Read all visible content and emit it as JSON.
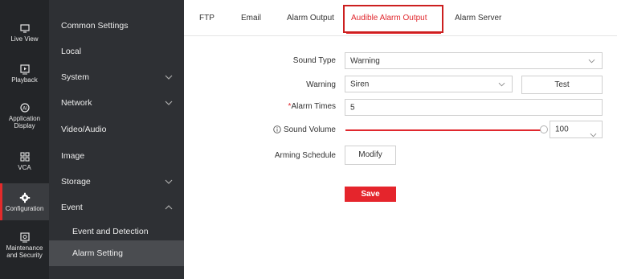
{
  "rail": [
    {
      "label": "Live View",
      "icon": "monitor-icon"
    },
    {
      "label": "Playback",
      "icon": "playback-icon"
    },
    {
      "label": "Application Display",
      "icon": "application-icon"
    },
    {
      "label": "VCA",
      "icon": "vca-icon"
    },
    {
      "label": "Configuration",
      "icon": "gear-icon",
      "active": true
    },
    {
      "label": "Maintenance and Security",
      "icon": "maintenance-icon"
    }
  ],
  "menu": [
    {
      "label": "Common Settings"
    },
    {
      "label": "Local"
    },
    {
      "label": "System",
      "chevron": "down"
    },
    {
      "label": "Network",
      "chevron": "down"
    },
    {
      "label": "Video/Audio"
    },
    {
      "label": "Image"
    },
    {
      "label": "Storage",
      "chevron": "down"
    },
    {
      "label": "Event",
      "chevron": "up"
    },
    {
      "label": "Event and Detection",
      "sub": true
    },
    {
      "label": "Alarm Setting",
      "sub": true,
      "selected": true
    }
  ],
  "tabs": [
    {
      "label": "FTP"
    },
    {
      "label": "Email"
    },
    {
      "label": "Alarm Output"
    },
    {
      "label": "Audible Alarm Output",
      "active": true
    },
    {
      "label": "Alarm Server"
    }
  ],
  "form": {
    "sound_type": {
      "label": "Sound Type",
      "value": "Warning"
    },
    "warning": {
      "label": "Warning",
      "value": "Siren",
      "test_label": "Test"
    },
    "alarm_times": {
      "required_mark": "*",
      "label": "Alarm Times",
      "value": "5"
    },
    "sound_volume": {
      "label": "Sound Volume",
      "value": "100",
      "level": 1.0
    },
    "arming_schedule": {
      "label": "Arming Schedule",
      "button": "Modify"
    },
    "save_label": "Save"
  },
  "colors": {
    "accent": "#e0282e",
    "rail_bg": "#232528",
    "menu_bg": "#2e3034"
  }
}
